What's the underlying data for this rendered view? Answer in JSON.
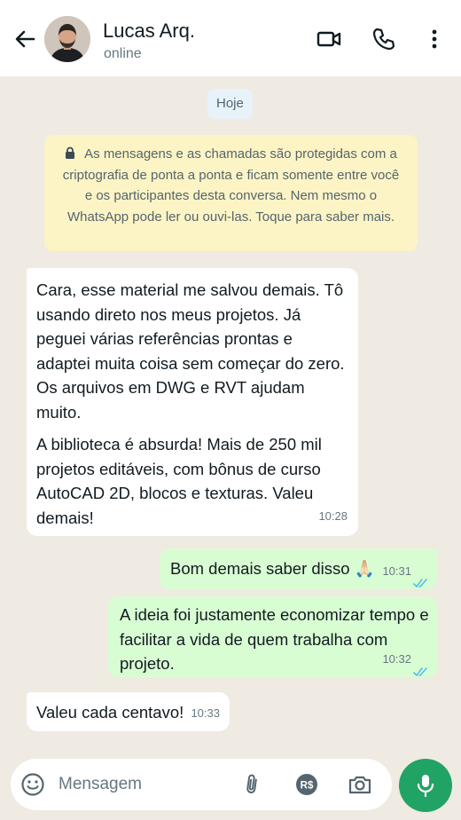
{
  "header": {
    "contact_name": "Lucas Arq.",
    "status": "online",
    "icons": [
      "back-arrow-icon",
      "video-call-icon",
      "voice-call-icon",
      "more-options-icon"
    ]
  },
  "chat": {
    "date_chip": "Hoje",
    "encryption_notice": "As mensagens e as chamadas são protegidas com a criptografia de ponta a ponta e ficam somente entre você e os participantes desta conversa. Nem mesmo o WhatsApp pode ler ou ouvi-las. Toque para saber mais.",
    "messages": [
      {
        "direction": "incoming",
        "paragraph1": "Cara, esse material me salvou demais. Tô usando direto nos meus projetos. Já peguei várias referências prontas e adaptei muita coisa sem começar do zero. Os arquivos em DWG e RVT ajudam muito.",
        "paragraph2": "A biblioteca é absurda! Mais de 250 mil projetos editáveis, com bônus de curso AutoCAD 2D, blocos e texturas. Valeu demais!",
        "time": "10:28"
      },
      {
        "direction": "outgoing",
        "text": "Bom demais saber disso 🙏🏻",
        "time": "10:31",
        "status": "read"
      },
      {
        "direction": "outgoing",
        "text": "A ideia foi justamente economizar tempo e facilitar a vida de quem trabalha com projeto.",
        "time": "10:32",
        "status": "read"
      },
      {
        "direction": "incoming",
        "text": "Valeu cada centavo!",
        "time": "10:33"
      }
    ]
  },
  "composer": {
    "placeholder": "Mensagem",
    "value": "",
    "icons": [
      "emoji-icon",
      "attach-icon",
      "payment-icon",
      "camera-icon",
      "mic-icon"
    ]
  },
  "colors": {
    "chat_background": "#efeae2",
    "incoming_bubble": "#ffffff",
    "outgoing_bubble": "#d9fdd3",
    "notice_background": "#fdf4c5",
    "read_ticks": "#53bdeb",
    "mic_button": "#21a366"
  }
}
